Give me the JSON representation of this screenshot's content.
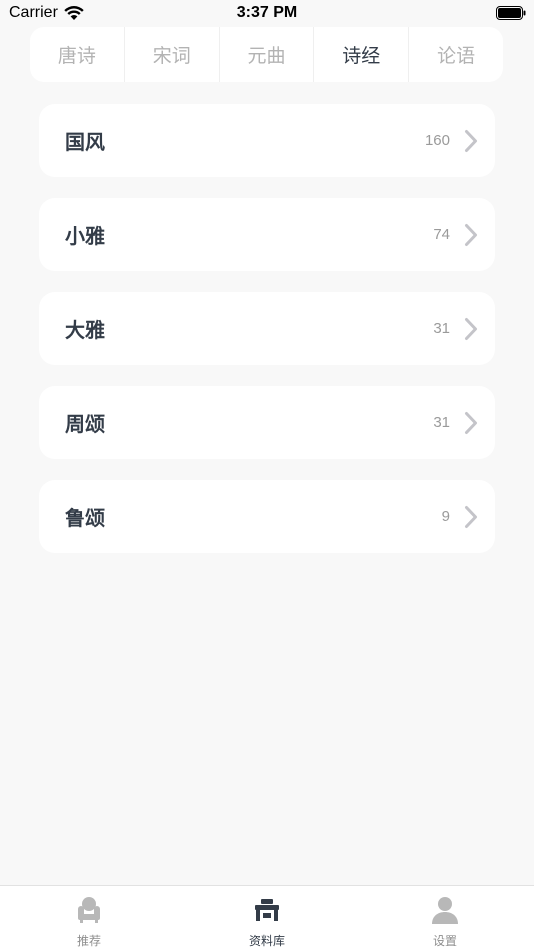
{
  "status_bar": {
    "carrier": "Carrier",
    "time": "3:37 PM"
  },
  "tabs": [
    {
      "label": "唐诗",
      "active": false
    },
    {
      "label": "宋词",
      "active": false
    },
    {
      "label": "元曲",
      "active": false
    },
    {
      "label": "诗经",
      "active": true
    },
    {
      "label": "论语",
      "active": false
    }
  ],
  "categories": [
    {
      "title": "国风",
      "count": "160"
    },
    {
      "title": "小雅",
      "count": "74"
    },
    {
      "title": "大雅",
      "count": "31"
    },
    {
      "title": "周颂",
      "count": "31"
    },
    {
      "title": "鲁颂",
      "count": "9"
    }
  ],
  "tab_bar": [
    {
      "label": "推荐",
      "icon": "armchair-icon",
      "active": false
    },
    {
      "label": "资料库",
      "icon": "desk-icon",
      "active": true
    },
    {
      "label": "设置",
      "icon": "person-icon",
      "active": false
    }
  ],
  "colors": {
    "background": "#f8f8f8",
    "card": "#ffffff",
    "text_primary": "#333c48",
    "text_muted": "#b3b3b3",
    "count": "#9a9a9a",
    "chevron": "#c4c4c9"
  }
}
